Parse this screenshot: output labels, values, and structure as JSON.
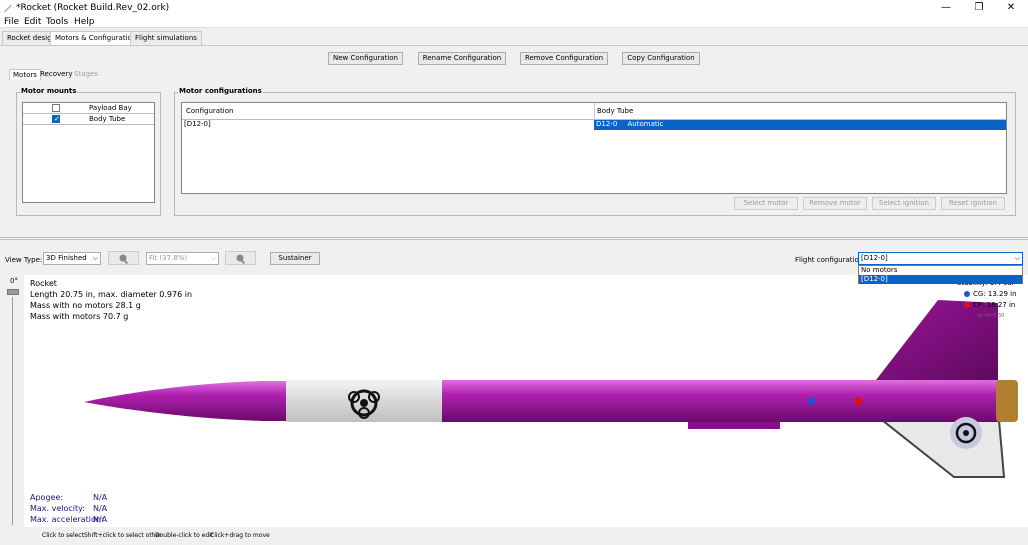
{
  "window": {
    "title": "*Rocket (Rocket Build.Rev_02.ork)",
    "minimize": "—",
    "maximize": "❐",
    "close": "✕"
  },
  "menu": [
    "File",
    "Edit",
    "Tools",
    "Help"
  ],
  "main_tabs": [
    "Rocket design",
    "Motors & Configuration",
    "Flight simulations"
  ],
  "config_buttons": [
    "New Configuration",
    "Rename Configuration",
    "Remove Configuration",
    "Copy Configuration"
  ],
  "sub_tabs": [
    "Motors",
    "Recovery",
    "Stages"
  ],
  "motor_mounts": {
    "title": "Motor mounts",
    "items": [
      {
        "label": "Payload Bay",
        "checked": false
      },
      {
        "label": "Body Tube",
        "checked": true
      }
    ]
  },
  "motor_configurations": {
    "title": "Motor configurations",
    "headers": [
      "Configuration",
      "Body Tube"
    ],
    "rows": [
      {
        "config": "[D12-0]",
        "motor": "D12-0",
        "ignition": "Automatic"
      }
    ]
  },
  "action_buttons": [
    "Select motor",
    "Remove motor",
    "Select ignition",
    "Reset ignition"
  ],
  "view": {
    "type_label": "View Type:",
    "type_value": "3D Finished",
    "zoom_value": "Fit (37.8%)",
    "stage_button": "Sustainer",
    "flight_config_label": "Flight configuration:",
    "flight_config_value": "[D12-0]",
    "flight_config_options": [
      "No motors",
      "[D12-0]"
    ],
    "rotation": "0°"
  },
  "rocket_info": {
    "name": "Rocket",
    "length": "Length 20.75 in, max. diameter 0.976 in",
    "mass_no_motors": "Mass with no motors 28.1 g",
    "mass_with_motors": "Mass with motors 70.7 g"
  },
  "stability": {
    "label": "Stability:",
    "value": "3.4 cal",
    "cg": "CG: 13.29 in",
    "cp": "CP: 16.27 in",
    "mach": "at M=0.30"
  },
  "flight_results": [
    {
      "label": "Apogee:",
      "value": "N/A"
    },
    {
      "label": "Max. velocity:",
      "value": "N/A"
    },
    {
      "label": "Max. acceleration:",
      "value": "N/A"
    }
  ],
  "status": [
    "Click to select",
    "Shift+click to select other",
    "Double-click to edit",
    "Click+drag to move"
  ],
  "colors": {
    "rocket": "#a01ea0",
    "selection": "#0a64c8",
    "panel": "#f0f0f0"
  }
}
